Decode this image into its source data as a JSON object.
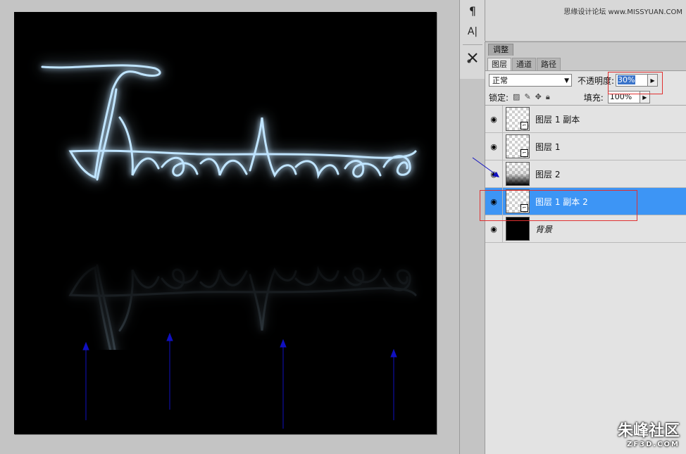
{
  "toolstrip": {
    "tools": [
      {
        "icon": "paragraph-icon",
        "glyph": "¶"
      },
      {
        "icon": "character-icon",
        "glyph": "A|"
      },
      {
        "icon": "tool-presets-icon",
        "glyph": "✂"
      }
    ]
  },
  "watermark_top": "思缘设计论坛 www.MISSYUAN.COM",
  "adjust_tab": "调整",
  "layers_panel": {
    "tabs": [
      "图层",
      "通道",
      "路径"
    ],
    "blend_mode": "正常",
    "opacity_label": "不透明度:",
    "opacity_value": "30%",
    "lock_label": "锁定:",
    "fill_label": "填充:",
    "fill_value": "100%",
    "layers": [
      {
        "name": "图层 1 副本",
        "thumb": "transparent",
        "linked": true,
        "selected": false
      },
      {
        "name": "图层 1",
        "thumb": "transparent",
        "linked": true,
        "selected": false
      },
      {
        "name": "图层 2",
        "thumb": "gradient",
        "linked": false,
        "selected": false
      },
      {
        "name": "图层 1 副本 2",
        "thumb": "transparent",
        "linked": true,
        "selected": true
      },
      {
        "name": "背景",
        "thumb": "black",
        "linked": false,
        "selected": false
      }
    ]
  },
  "logo": {
    "zh": "朱峰社区",
    "en": "ZF3D.COM"
  },
  "colors": {
    "selection": "#3d95f5",
    "neon": "#7ec8ff",
    "annotation_arrow": "#1010c0",
    "highlight_box": "#e03030"
  }
}
